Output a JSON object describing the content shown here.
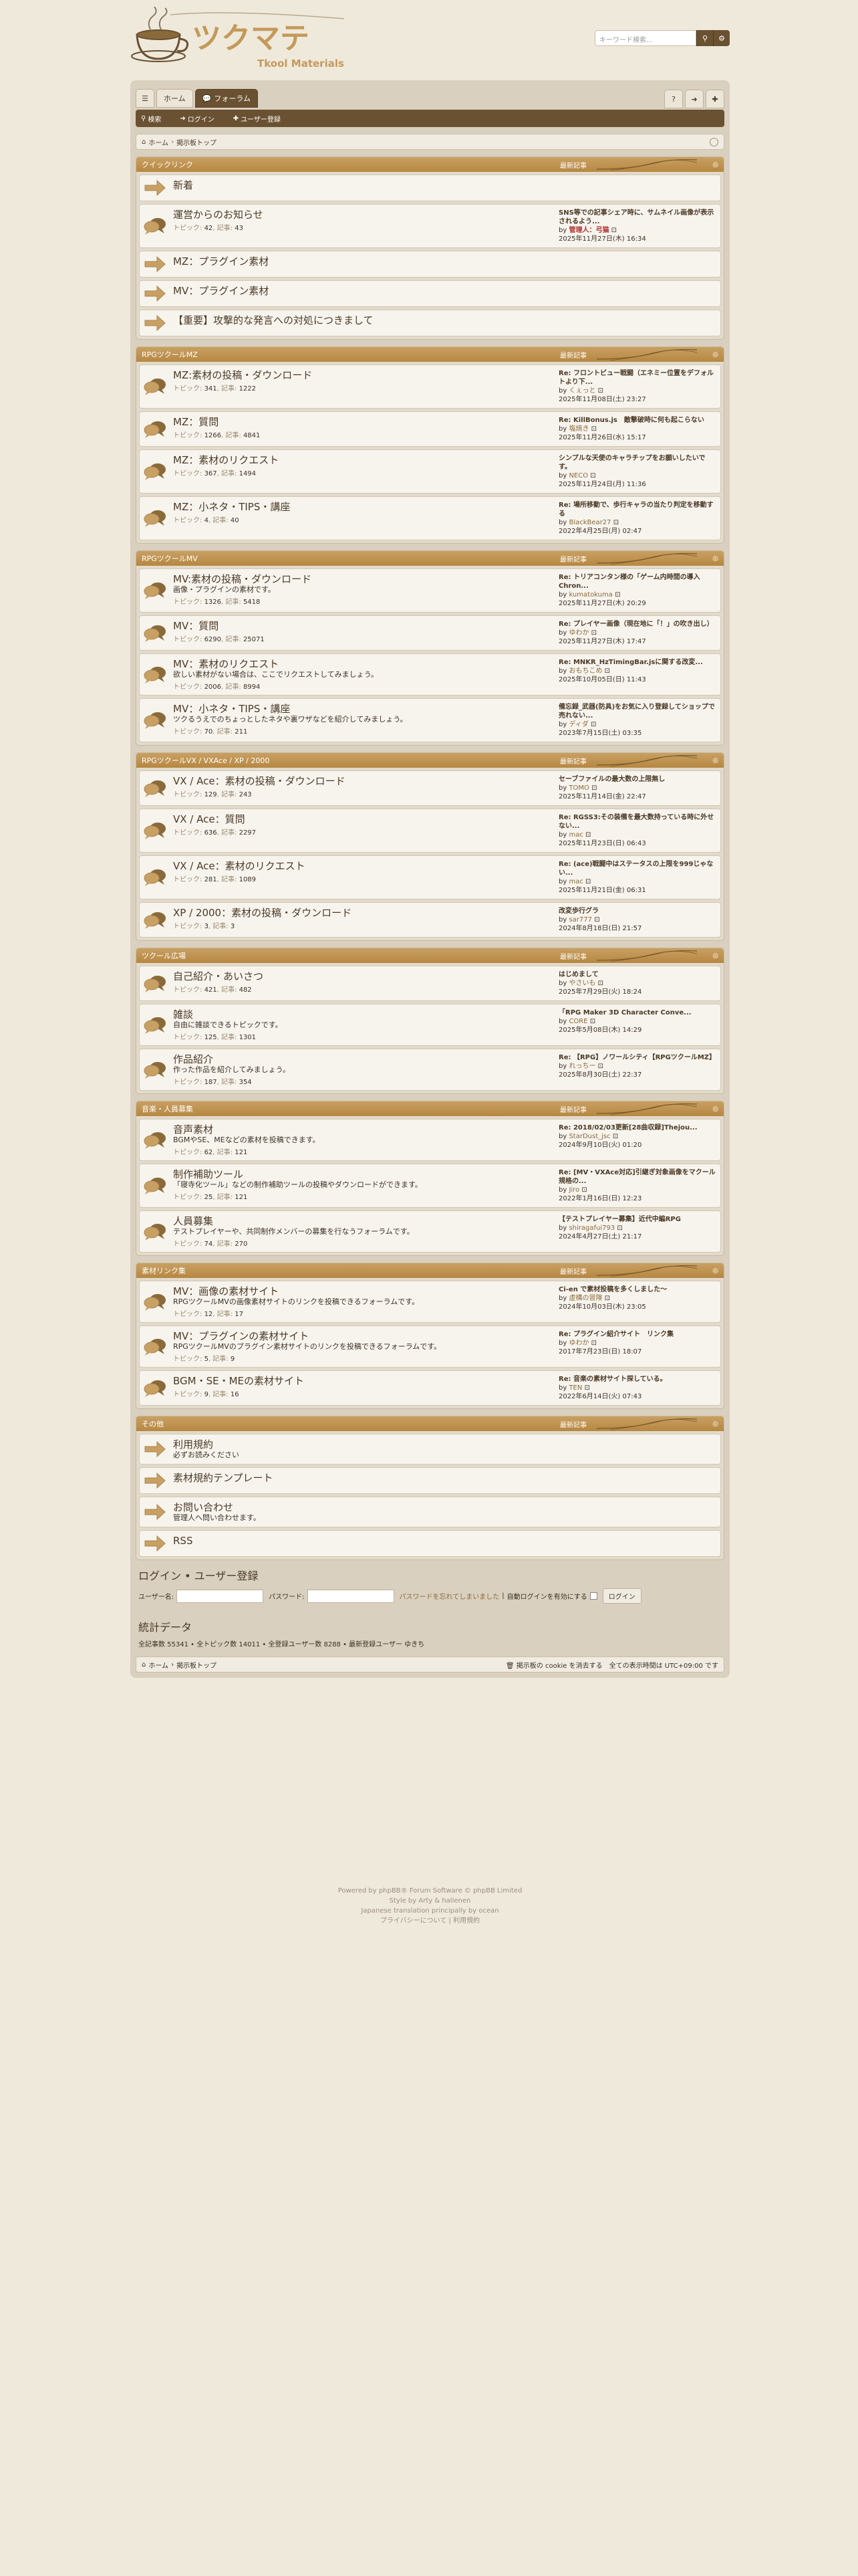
{
  "header": {
    "logo_text": "ツクマテ",
    "logo_sub": "Tkool Materials",
    "search_placeholder": "キーワード検索..."
  },
  "nav": {
    "home": "ホーム",
    "forum": "フォーラム"
  },
  "subnav": {
    "search": "検索",
    "login": "ログイン",
    "register": "ユーザー登録"
  },
  "breadcrumb": {
    "home": "ホーム",
    "board": "掲示板トップ"
  },
  "last_post_label": "最新記事",
  "categories": [
    {
      "name": "クイックリンク",
      "forums": [
        {
          "title": "新着",
          "type": "link"
        },
        {
          "title": "運営からのお知らせ",
          "type": "forum",
          "topics": "42",
          "posts": "43",
          "last_title": "SNS等での記事シェア時に、サムネイル画像が表示されるよう...",
          "last_by": "管理人：弓猫",
          "by_red": true,
          "last_date": "2025年11月27日(木) 16:34"
        },
        {
          "title": "MZ：プラグイン素材",
          "type": "link"
        },
        {
          "title": "MV：プラグイン素材",
          "type": "link"
        },
        {
          "title": "【重要】攻撃的な発言への対処につきまして",
          "type": "link"
        }
      ]
    },
    {
      "name": "RPGツクールMZ",
      "forums": [
        {
          "title": "MZ:素材の投稿・ダウンロード",
          "type": "forum",
          "topics": "341",
          "posts": "1222",
          "last_title": "Re: フロントビュー戦闘（エネミー位置をデフォルトより下...",
          "last_by": "くぇっと",
          "last_date": "2025年11月08日(土) 23:27"
        },
        {
          "title": "MZ：質問",
          "type": "forum",
          "topics": "1266",
          "posts": "4841",
          "last_title": "Re: KillBonus.js　敵撃破時に何も起こらない",
          "last_by": "塩焼き",
          "last_date": "2025年11月26日(水) 15:17"
        },
        {
          "title": "MZ：素材のリクエスト",
          "type": "forum",
          "topics": "367",
          "posts": "1494",
          "last_title": "シンプルな天使のキャラチップをお願いしたいです。",
          "last_by": "NECO",
          "last_date": "2025年11月24日(月) 11:36"
        },
        {
          "title": "MZ：小ネタ・TIPS・講座",
          "type": "forum",
          "topics": "4",
          "posts": "40",
          "last_title": "Re: 場所移動で、歩行キャラの当たり判定を移動する",
          "last_by": "BlackBear27",
          "last_date": "2022年4月25日(月) 02:47"
        }
      ]
    },
    {
      "name": "RPGツクールMV",
      "forums": [
        {
          "title": "MV:素材の投稿・ダウンロード",
          "type": "forum",
          "desc": "画像・プラグインの素材です。",
          "topics": "1326",
          "posts": "5418",
          "last_title": "Re: トリアコンタン様の「ゲーム内時間の導入 Chron...",
          "last_by": "kumatokuma",
          "last_date": "2025年11月27日(木) 20:29"
        },
        {
          "title": "MV：質問",
          "type": "forum",
          "topics": "6290",
          "posts": "25071",
          "last_title": "Re: プレイヤー画像（現在地に「！」の吹き出し）",
          "last_by": "ゆわか",
          "last_date": "2025年11月27日(木) 17:47"
        },
        {
          "title": "MV：素材のリクエスト",
          "type": "forum",
          "desc": "欲しい素材がない場合は、ここでリクエストしてみましょう。",
          "topics": "2006",
          "posts": "8994",
          "last_title": "Re: MNKR_HzTimingBar.jsに関する改変...",
          "last_by": "おもちこめ",
          "last_date": "2025年10月05日(日) 11:43"
        },
        {
          "title": "MV：小ネタ・TIPS・講座",
          "type": "forum",
          "desc": "ツクるうえでのちょっとしたネタや裏ワザなどを紹介してみましょう。",
          "topics": "70",
          "posts": "211",
          "last_title": "備忘録_武器(防具)をお気に入り登録してショップで売れない...",
          "last_by": "ディダ",
          "last_date": "2023年7月15日(土) 03:35"
        }
      ]
    },
    {
      "name": "RPGツクールVX / VXAce / XP / 2000",
      "forums": [
        {
          "title": "VX / Ace：素材の投稿・ダウンロード",
          "type": "forum",
          "topics": "129",
          "posts": "243",
          "last_title": "セーブファイルの最大数の上限無し",
          "last_by": "TOMO",
          "last_date": "2025年11月14日(金) 22:47"
        },
        {
          "title": "VX / Ace：質問",
          "type": "forum",
          "topics": "636",
          "posts": "2297",
          "last_title": "Re: RGSS3:その装備を最大数持っている時に外せない...",
          "last_by": "mac",
          "last_date": "2025年11月23日(日) 06:43"
        },
        {
          "title": "VX / Ace：素材のリクエスト",
          "type": "forum",
          "topics": "281",
          "posts": "1089",
          "last_title": "Re: (ace)戦闘中はステータスの上限を999じゃない...",
          "last_by": "mac",
          "last_date": "2025年11月21日(金) 06:31"
        },
        {
          "title": "XP / 2000：素材の投稿・ダウンロード",
          "type": "forum",
          "topics": "3",
          "posts": "3",
          "last_title": "改変歩行グラ",
          "last_by": "sar777",
          "last_date": "2024年8月18日(日) 21:57"
        }
      ]
    },
    {
      "name": "ツクール広場",
      "forums": [
        {
          "title": "自己紹介・あいさつ",
          "type": "forum",
          "topics": "421",
          "posts": "482",
          "last_title": "はじめまして",
          "last_by": "やさいも",
          "last_date": "2025年7月29日(火) 18:24"
        },
        {
          "title": "雑談",
          "type": "forum",
          "desc": "自由に雑談できるトピックです。",
          "topics": "125",
          "posts": "1301",
          "last_title": "「RPG Maker 3D Character Conve...",
          "last_by": "CORE",
          "last_date": "2025年5月08日(木) 14:29"
        },
        {
          "title": "作品紹介",
          "type": "forum",
          "desc": "作った作品を紹介してみましょう。",
          "topics": "187",
          "posts": "354",
          "last_title": "Re: 【RPG】ノワールシティ【RPGツクールMZ】",
          "last_by": "れっちー",
          "last_date": "2025年8月30日(土) 22:37"
        }
      ]
    },
    {
      "name": "音楽・人員募集",
      "forums": [
        {
          "title": "音声素材",
          "type": "forum",
          "desc": "BGMやSE、MEなどの素材を投稿できます。",
          "topics": "62",
          "posts": "121",
          "last_title": "Re: 2018/02/03更新[28曲収録]Thejou...",
          "last_by": "StarDust_jsc",
          "last_date": "2024年9月10日(火) 01:20"
        },
        {
          "title": "制作補助ツール",
          "type": "forum",
          "desc": "「寝寺化ツール」などの制作補助ツールの投稿やダウンロードができます。",
          "topics": "25",
          "posts": "121",
          "last_title": "Re: [MV・VXAce対応]引継ぎ対象画像をマクール規格の...",
          "last_by": "Jiro",
          "last_date": "2022年1月16日(日) 12:23"
        },
        {
          "title": "人員募集",
          "type": "forum",
          "desc": "テストプレイヤーや、共同制作メンバーの募集を行なうフォーラムです。",
          "topics": "74",
          "posts": "270",
          "last_title": "【テストプレイヤー募集】近代中編RPG",
          "last_by": "shiragafui793",
          "last_date": "2024年4月27日(土) 21:17"
        }
      ]
    },
    {
      "name": "素材リンク集",
      "forums": [
        {
          "title": "MV：画像の素材サイト",
          "type": "forum",
          "desc": "RPGツクールMVの画像素材サイトのリンクを投稿できるフォーラムです。",
          "topics": "12",
          "posts": "17",
          "last_title": "Ci-en で素材投稿を多くしました〜",
          "last_by": "虚構の冒険",
          "last_date": "2024年10月03日(木) 23:05"
        },
        {
          "title": "MV：プラグインの素材サイト",
          "type": "forum",
          "desc": "RPGツクールMVのプラグイン素材サイトのリンクを投稿できるフォーラムです。",
          "topics": "5",
          "posts": "9",
          "last_title": "Re: プラグイン紹介サイト　リンク集",
          "last_by": "ゆわか",
          "last_date": "2017年7月23日(日) 18:07"
        },
        {
          "title": "BGM・SE・MEの素材サイト",
          "type": "forum",
          "topics": "9",
          "posts": "16",
          "last_title": "Re: 音楽の素材サイト探している。",
          "last_by": "TEN",
          "last_date": "2022年6月14日(火) 07:43"
        }
      ]
    },
    {
      "name": "その他",
      "forums": [
        {
          "title": "利用規約",
          "type": "link",
          "desc": "必ずお読みください"
        },
        {
          "title": "素材規約テンプレート",
          "type": "link"
        },
        {
          "title": "お問い合わせ",
          "type": "link",
          "desc": "管理人へ問い合わせます。"
        },
        {
          "title": "RSS",
          "type": "link"
        }
      ]
    }
  ],
  "labels": {
    "topics": "トピック:",
    "posts": "記事:",
    "by": "by"
  },
  "login": {
    "heading": "ログイン",
    "sep": "•",
    "register": "ユーザー登録",
    "user_label": "ユーザー名:",
    "pass_label": "パスワード:",
    "forgot": "パスワードを忘れてしまいました",
    "auto": "自動ログインを有効にする",
    "button": "ログイン"
  },
  "stats": {
    "heading": "統計データ",
    "line": "全記事数 55341 • 全トピック数 14011 • 全登録ユーザー数 8288 • 最新登録ユーザー ゆきち"
  },
  "footer": {
    "home": "ホーム",
    "board": "掲示板トップ",
    "cookie": "掲示板の cookie を消去する",
    "tz": "全ての表示時間は UTC+09:00 です"
  },
  "copyright": {
    "line1": "Powered by phpBB® Forum Software © phpBB Limited",
    "line2": "Style by Arty & hallenen",
    "line3": "Japanese translation principally by ocean",
    "line4": "プライバシーについて | 利用規約"
  }
}
